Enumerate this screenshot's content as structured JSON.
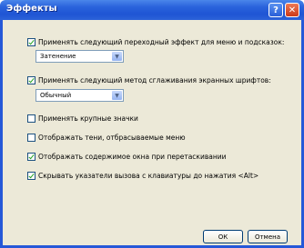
{
  "window": {
    "title": "Эффекты",
    "help_glyph": "?",
    "close_glyph": "✕"
  },
  "options": [
    {
      "label": "Применять следующий переходный эффект для меню и подсказок:",
      "checked": true
    },
    {
      "label": "Применять следующий метод сглаживания экранных шрифтов:",
      "checked": true
    },
    {
      "label": "Применять крупные значки",
      "checked": false
    },
    {
      "label": "Отображать тени, отбрасываемые меню",
      "checked": false
    },
    {
      "label": "Отображать содержимое окна при перетаскивании",
      "checked": true
    },
    {
      "label": "Скрывать указатели вызова с клавиатуры до нажатия <Alt>",
      "checked": true
    }
  ],
  "transition_select": {
    "value": "Затенение",
    "arrow": "▼"
  },
  "smoothing_select": {
    "value": "Обычный",
    "arrow": "▼"
  },
  "buttons": {
    "ok": "ОК",
    "cancel": "Отмена"
  }
}
